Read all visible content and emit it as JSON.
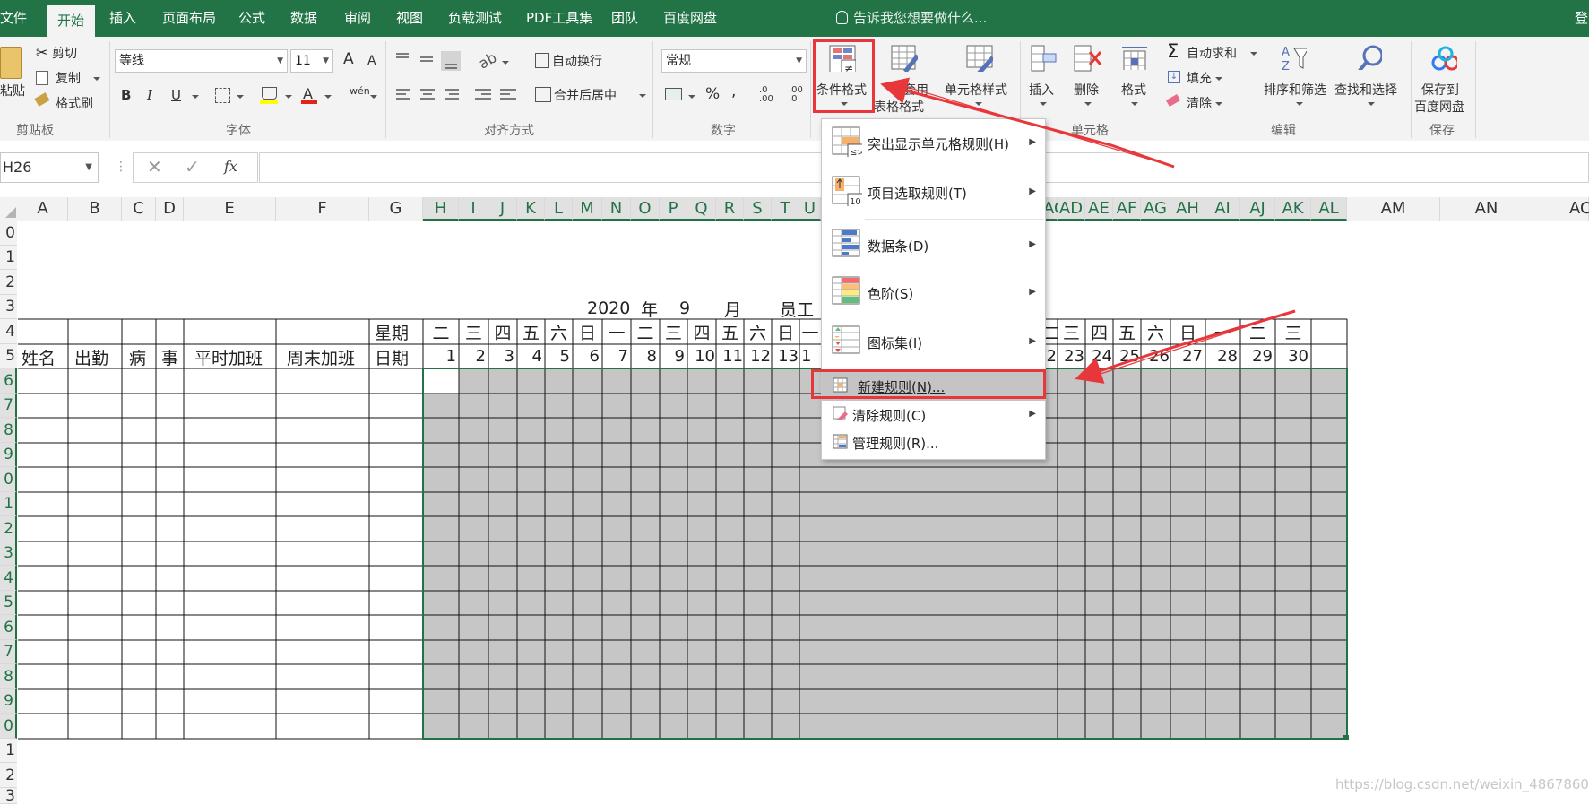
{
  "tabs": [
    "文件",
    "开始",
    "插入",
    "页面布局",
    "公式",
    "数据",
    "审阅",
    "视图",
    "负载测试",
    "PDF工具集",
    "团队",
    "百度网盘"
  ],
  "active_tab": "开始",
  "tell_me": "告诉我您想要做什么...",
  "login": "登",
  "clipboard": {
    "cut": "剪切",
    "copy": "复制",
    "format_painter": "格式刷",
    "paste": "粘贴",
    "group": "剪贴板"
  },
  "font": {
    "name": "等线",
    "size": "11",
    "bold": "B",
    "italic": "I",
    "underline": "U",
    "phonetic": "wén",
    "group": "字体",
    "grow": "A",
    "shrink": "A",
    "font_color": "A"
  },
  "alignment": {
    "wrap": "自动换行",
    "merge": "合并后居中",
    "group": "对齐方式"
  },
  "number": {
    "format": "常规",
    "percent": "%",
    "comma": ",",
    "inc": ".0 .00",
    "dec": ".00 .0",
    "group": "数字"
  },
  "styles": {
    "conditional": "条件格式",
    "table_line1": "套用",
    "table_line2": "表格格式",
    "cell_styles": "单元格样式",
    "group": "样式"
  },
  "cells": {
    "insert": "插入",
    "delete": "删除",
    "format": "格式",
    "group": "单元格"
  },
  "editing": {
    "autosum": "自动求和",
    "fill": "填充",
    "clear": "清除",
    "sort": "排序和筛选",
    "find": "查找和选择",
    "group": "编辑"
  },
  "save": {
    "line1": "保存到",
    "line2": "百度网盘",
    "group": "保存"
  },
  "name_box": "H26",
  "fx": "fx",
  "columns": [
    "A",
    "B",
    "C",
    "D",
    "E",
    "F",
    "G",
    "H",
    "I",
    "J",
    "K",
    "L",
    "M",
    "N",
    "O",
    "P",
    "Q",
    "R",
    "S",
    "T",
    "U",
    "AC",
    "AD",
    "AE",
    "AF",
    "AG",
    "AH",
    "AI",
    "AJ",
    "AK",
    "AL",
    "AM",
    "AN",
    "AO"
  ],
  "rows": [
    "0",
    "1",
    "2",
    "3",
    "4",
    "5",
    "6",
    "7",
    "8",
    "9",
    "0",
    "1",
    "2",
    "3",
    "4",
    "5",
    "6",
    "7",
    "8",
    "9",
    "0",
    "1",
    "2",
    "3"
  ],
  "sheet": {
    "title_year": "2020",
    "title_nian": "年",
    "title_month": "9",
    "title_yue": "月",
    "title_rest": "员工",
    "xingqi": "星期",
    "riqi": "日期",
    "headers": [
      "姓名",
      "出勤",
      "病",
      "事",
      "平时加班",
      "周末加班"
    ],
    "weekdays_left": [
      "二",
      "三",
      "四",
      "五",
      "六",
      "日",
      "一",
      "二",
      "三",
      "四",
      "五",
      "六",
      "日",
      "一"
    ],
    "weekdays_right": [
      "二",
      "三",
      "四",
      "五",
      "六",
      "日",
      "一",
      "二",
      "三"
    ],
    "dates_left": [
      "1",
      "2",
      "3",
      "4",
      "5",
      "6",
      "7",
      "8",
      "9",
      "10",
      "11",
      "12",
      "13",
      "1"
    ],
    "dates_right": [
      "2",
      "23",
      "24",
      "25",
      "26",
      "27",
      "28",
      "29",
      "30"
    ]
  },
  "menu": {
    "items": [
      {
        "label": "突出显示单元格规则(H)",
        "submenu": true
      },
      {
        "label": "项目选取规则(T)",
        "submenu": true
      },
      {
        "label": "数据条(D)",
        "submenu": true
      },
      {
        "label": "色阶(S)",
        "submenu": true
      },
      {
        "label": "图标集(I)",
        "submenu": true
      },
      {
        "label": "新建规则(N)...",
        "submenu": false
      },
      {
        "label": "清除规则(C)",
        "submenu": true
      },
      {
        "label": "管理规则(R)...",
        "submenu": false
      }
    ],
    "icon_text_1": "≤>",
    "icon_text_2": "10"
  },
  "colors": {
    "accent": "#227447",
    "highlight": "#e8373b",
    "selection_fill": "#c6c6c6"
  },
  "watermark": "https://blog.csdn.net/weixin_48678602"
}
